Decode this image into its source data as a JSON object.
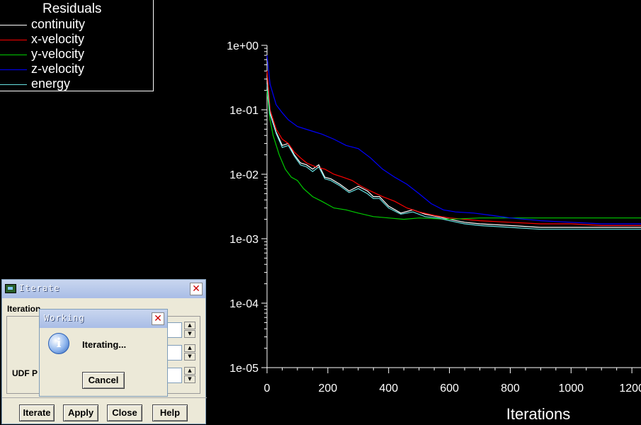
{
  "chart_data": {
    "type": "line",
    "yscale": "log",
    "xlabel": "Iterations",
    "ylabel": "",
    "xlim": [
      0,
      1230
    ],
    "ylim": [
      1e-05,
      1
    ],
    "x_ticks": [
      "0",
      "200",
      "400",
      "600",
      "800",
      "1000",
      "1200"
    ],
    "x_tick_values": [
      0,
      200,
      400,
      600,
      800,
      1000,
      1200
    ],
    "y_ticks": [
      "1e+00",
      "1e-01",
      "1e-02",
      "1e-03",
      "1e-04",
      "1e-05"
    ],
    "y_tick_values": [
      1,
      0.1,
      0.01,
      0.001,
      0.0001,
      1e-05
    ],
    "legend_title": "Residuals",
    "legend_position": "top-left",
    "series": [
      {
        "name": "continuity",
        "color": "#ffffff",
        "x": [
          0,
          10,
          30,
          50,
          70,
          90,
          110,
          130,
          150,
          170,
          190,
          210,
          240,
          270,
          300,
          330,
          350,
          370,
          400,
          440,
          480,
          520,
          560,
          600,
          650,
          700,
          800,
          900,
          1000,
          1100,
          1230
        ],
        "y": [
          0.3,
          0.09,
          0.045,
          0.028,
          0.03,
          0.02,
          0.015,
          0.014,
          0.012,
          0.014,
          0.009,
          0.0085,
          0.007,
          0.0055,
          0.0065,
          0.0055,
          0.0045,
          0.0045,
          0.0032,
          0.0025,
          0.0028,
          0.0024,
          0.0022,
          0.002,
          0.0018,
          0.0017,
          0.0016,
          0.0015,
          0.0015,
          0.0015,
          0.0015
        ]
      },
      {
        "name": "x-velocity",
        "color": "#ff0000",
        "x": [
          0,
          10,
          30,
          50,
          70,
          90,
          110,
          130,
          160,
          190,
          220,
          250,
          280,
          310,
          340,
          380,
          420,
          460,
          500,
          550,
          600,
          700,
          800,
          900,
          1000,
          1100,
          1230
        ],
        "y": [
          0.4,
          0.1,
          0.05,
          0.035,
          0.03,
          0.022,
          0.018,
          0.015,
          0.013,
          0.012,
          0.01,
          0.009,
          0.008,
          0.0065,
          0.0055,
          0.0045,
          0.0038,
          0.003,
          0.0026,
          0.0023,
          0.0021,
          0.0019,
          0.0018,
          0.0017,
          0.0017,
          0.0016,
          0.0016
        ]
      },
      {
        "name": "y-velocity",
        "color": "#00cc00",
        "x": [
          0,
          10,
          20,
          40,
          60,
          80,
          100,
          120,
          150,
          180,
          220,
          260,
          300,
          350,
          400,
          450,
          500,
          600,
          700,
          800,
          900,
          1000,
          1100,
          1230
        ],
        "y": [
          0.2,
          0.07,
          0.04,
          0.02,
          0.012,
          0.009,
          0.008,
          0.006,
          0.0045,
          0.0038,
          0.003,
          0.0028,
          0.0025,
          0.0022,
          0.0021,
          0.002,
          0.0021,
          0.002,
          0.0021,
          0.0021,
          0.0021,
          0.0021,
          0.0021,
          0.0021
        ]
      },
      {
        "name": "z-velocity",
        "color": "#0000ff",
        "x": [
          0,
          10,
          30,
          50,
          70,
          100,
          140,
          180,
          220,
          260,
          300,
          340,
          380,
          420,
          460,
          500,
          540,
          580,
          620,
          680,
          740,
          800,
          900,
          1000,
          1100,
          1230
        ],
        "y": [
          0.7,
          0.25,
          0.12,
          0.09,
          0.07,
          0.055,
          0.048,
          0.042,
          0.035,
          0.028,
          0.025,
          0.018,
          0.012,
          0.009,
          0.007,
          0.005,
          0.0035,
          0.0028,
          0.0026,
          0.0025,
          0.0023,
          0.0021,
          0.0019,
          0.0018,
          0.0017,
          0.0017
        ]
      },
      {
        "name": "energy",
        "color": "#66e0e0",
        "x": [
          0,
          10,
          30,
          50,
          70,
          90,
          110,
          130,
          150,
          170,
          190,
          210,
          240,
          270,
          300,
          330,
          350,
          370,
          400,
          440,
          480,
          520,
          560,
          600,
          650,
          700,
          800,
          900,
          1000,
          1100,
          1230
        ],
        "y": [
          0.25,
          0.085,
          0.043,
          0.026,
          0.028,
          0.019,
          0.014,
          0.013,
          0.011,
          0.013,
          0.0085,
          0.008,
          0.0066,
          0.0052,
          0.006,
          0.005,
          0.0042,
          0.0042,
          0.003,
          0.0024,
          0.0026,
          0.0022,
          0.0021,
          0.0019,
          0.0017,
          0.0016,
          0.0015,
          0.0014,
          0.0014,
          0.0014,
          0.0014
        ]
      }
    ]
  },
  "iterate_dialog": {
    "title": "Iterate",
    "group_label": "Iteration",
    "udf_label": "UDF P",
    "buttons": {
      "iterate": "Iterate",
      "apply": "Apply",
      "close": "Close",
      "help": "Help"
    }
  },
  "working_dialog": {
    "title": "Working",
    "message": "Iterating...",
    "cancel_label": "Cancel"
  },
  "icons": {
    "close": "close-icon",
    "info": "info-icon",
    "app": "app-icon"
  }
}
